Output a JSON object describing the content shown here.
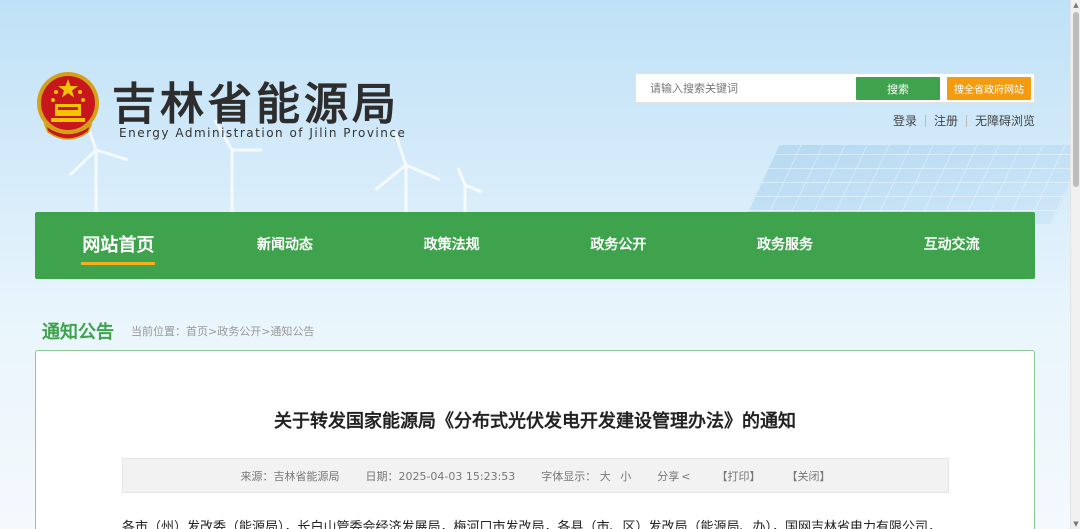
{
  "header": {
    "title": "吉林省能源局",
    "subtitle": "Energy Administration of Jilin Province"
  },
  "search": {
    "placeholder": "请输入搜索关键词",
    "button_label": "搜索",
    "all_sites_label": "搜全省政府网站"
  },
  "user_links": [
    "登录",
    "注册",
    "无障碍浏览"
  ],
  "nav": {
    "items": [
      "网站首页",
      "新闻动态",
      "政策法规",
      "政务公开",
      "政务服务",
      "互动交流"
    ],
    "active_index": 0
  },
  "section": {
    "title": "通知公告",
    "breadcrumb": "当前位置：首页>政务公开>通知公告"
  },
  "article": {
    "title": "关于转发国家能源局《分布式光伏发电开发建设管理办法》的通知",
    "meta": {
      "source_label": "来源：",
      "source": "吉林省能源局",
      "date_label": "日期：",
      "date": "2025-04-03 15:23:53",
      "font_label": "字体显示：",
      "font_large": "大",
      "font_small": "小",
      "share": "分享",
      "print": "【打印】",
      "close": "【关闭】"
    },
    "body_first_line": "各市（州）发改委（能源局），长白山管委会经济发展局，梅河口市发改局，各县（市、区）发改局（能源局、办），国网吉林省电力有限公司，"
  },
  "colors": {
    "primary_green": "#3fa34d",
    "accent_orange": "#f39c12",
    "nav_underline": "#f5b020"
  }
}
